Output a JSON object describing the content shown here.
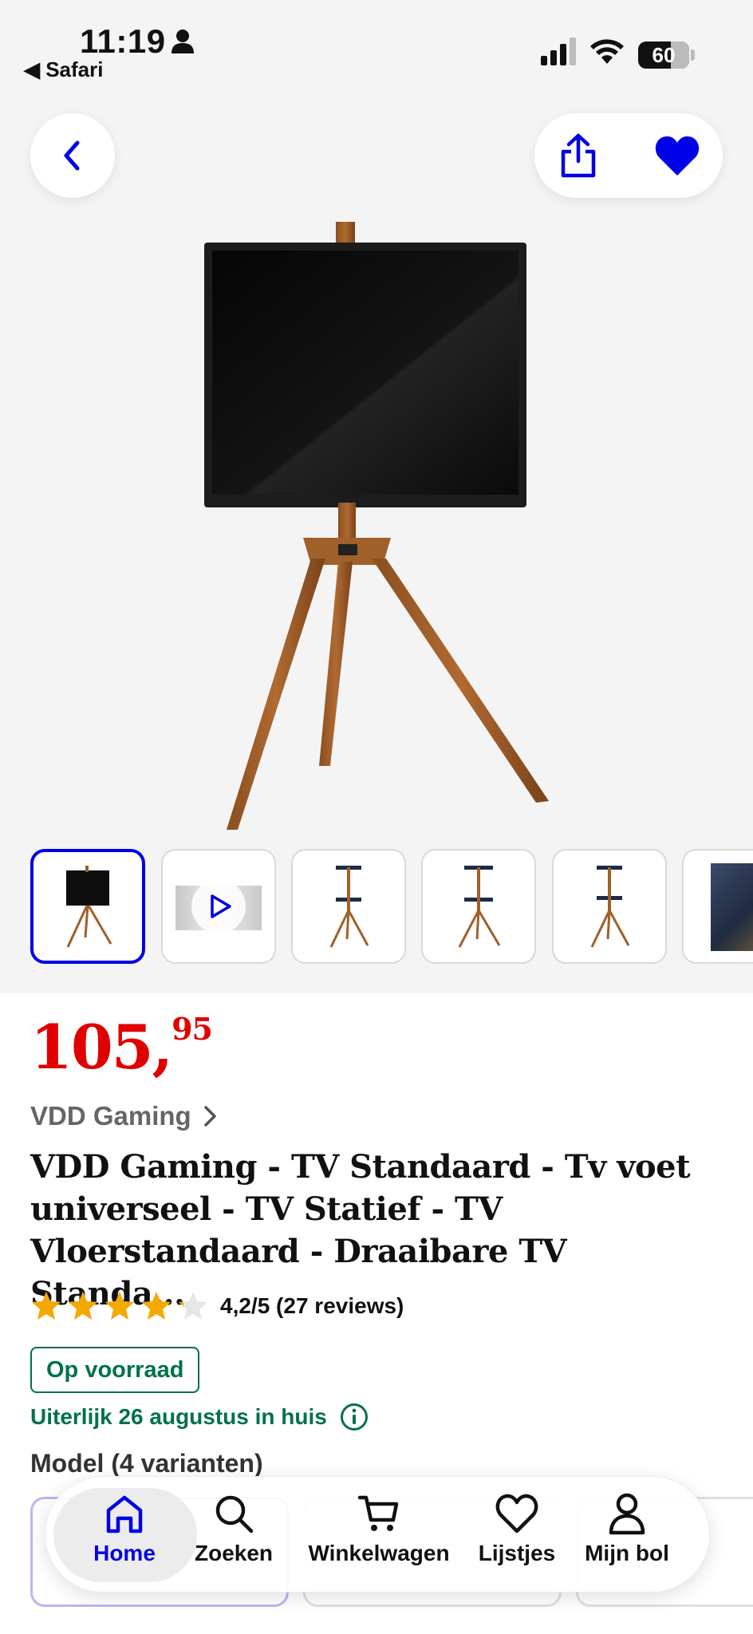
{
  "status_bar": {
    "time": "11:19",
    "back_app": "◀ Safari",
    "battery": "60"
  },
  "product": {
    "price_whole": "105,",
    "price_cents": "95",
    "brand": "VDD Gaming",
    "title": "VDD Gaming - TV Standaard - Tv voet universeel - TV Statief - TV Vloerstandaard - Draaibare TV Standa...",
    "rating_text": "4,2/5 (27 reviews)",
    "rating_value": 4.2,
    "rating_max": 5,
    "stock_badge": "Op voorraad",
    "delivery": "Uiterlijk 26 augustus in huis",
    "model_heading": "Model (4 varianten)"
  },
  "thumbnails": [
    {
      "kind": "image",
      "active": true
    },
    {
      "kind": "video",
      "active": false
    },
    {
      "kind": "image",
      "active": false
    },
    {
      "kind": "image",
      "active": false
    },
    {
      "kind": "image",
      "active": false
    },
    {
      "kind": "image",
      "active": false
    }
  ],
  "nav": {
    "items": [
      {
        "label": "Home",
        "icon": "home-icon",
        "active": true
      },
      {
        "label": "Zoeken",
        "icon": "search-icon",
        "active": false
      },
      {
        "label": "Winkelwagen",
        "icon": "cart-icon",
        "active": false
      },
      {
        "label": "Lijstjes",
        "icon": "heart-outline-icon",
        "active": false
      },
      {
        "label": "Mijn bol",
        "icon": "user-icon",
        "active": false
      }
    ]
  },
  "colors": {
    "accent": "#0000e6",
    "price": "#e00000",
    "stock": "#00724a",
    "star": "#f5a800"
  }
}
